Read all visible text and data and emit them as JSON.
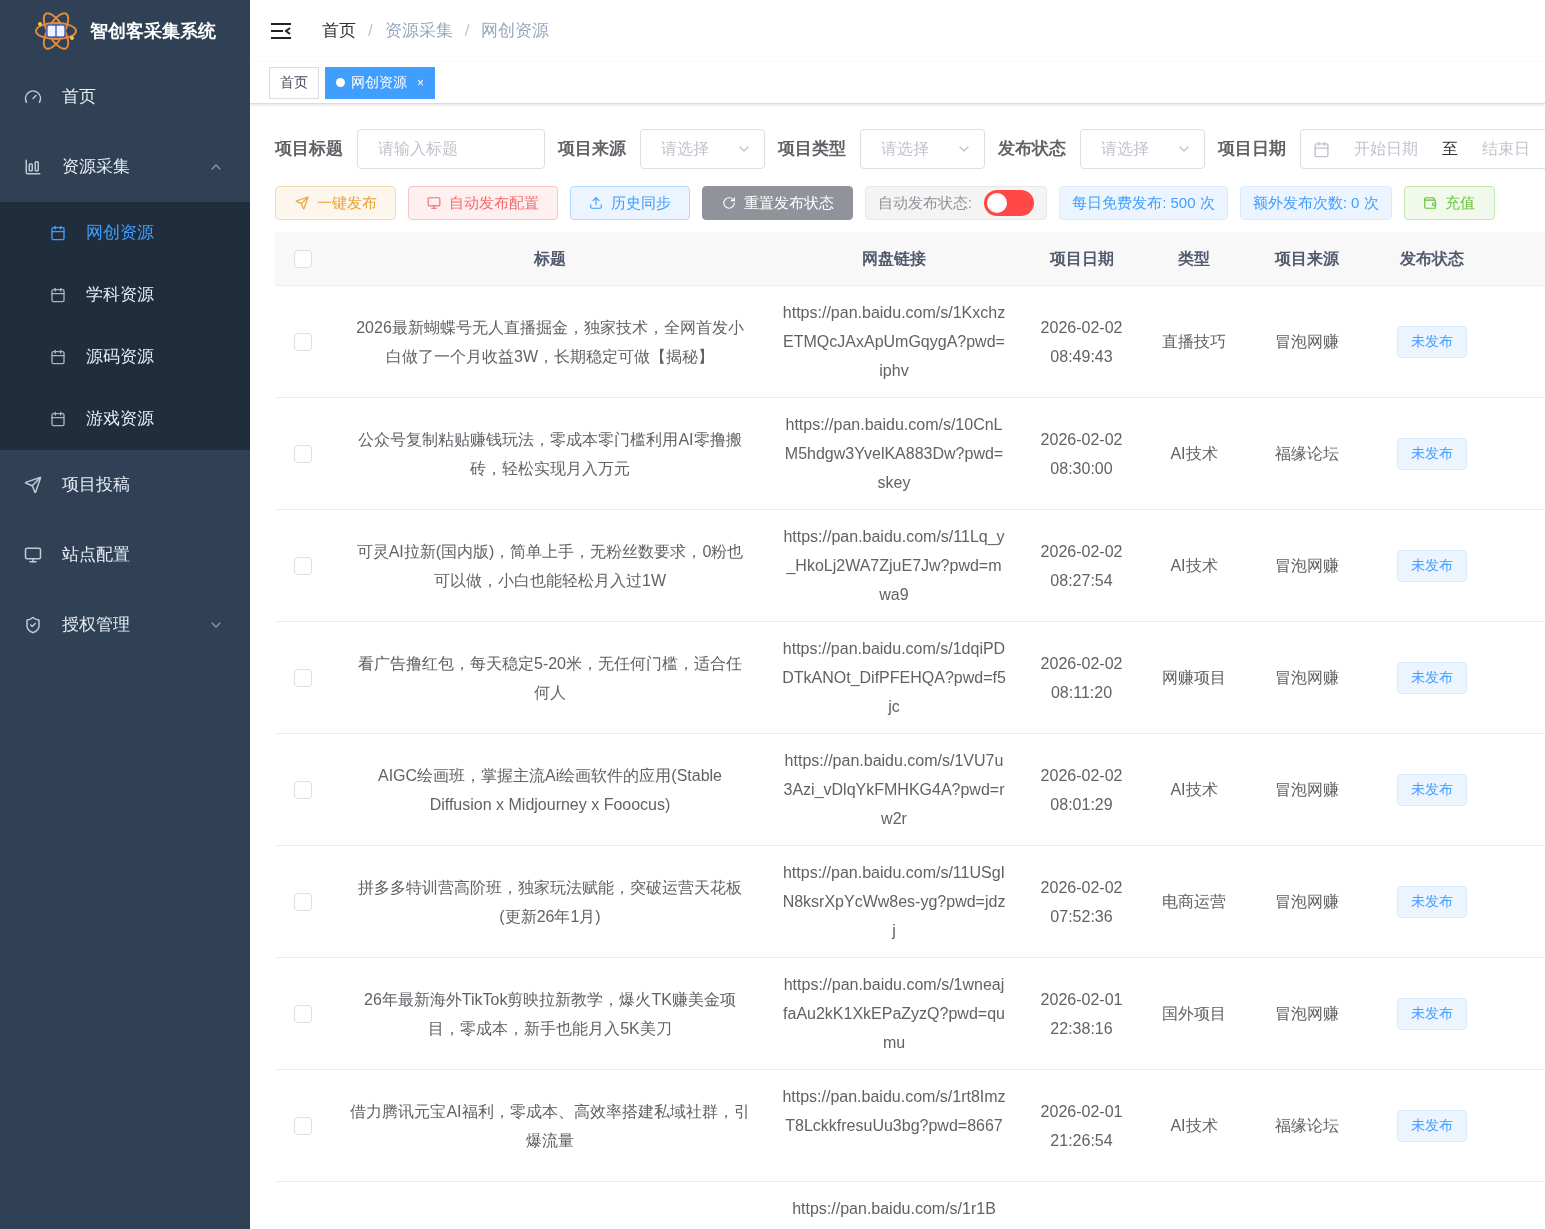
{
  "app": {
    "title": "智创客采集系统"
  },
  "sidebar": {
    "items": [
      {
        "label": "首页",
        "kind": "link",
        "selected": false
      },
      {
        "label": "资源采集",
        "kind": "submenu",
        "selected": false,
        "expanded": true,
        "children": [
          {
            "label": "网创资源",
            "selected": true
          },
          {
            "label": "学科资源",
            "selected": false
          },
          {
            "label": "源码资源",
            "selected": false
          },
          {
            "label": "游戏资源",
            "selected": false
          }
        ]
      },
      {
        "label": "项目投稿",
        "kind": "link",
        "selected": false
      },
      {
        "label": "站点配置",
        "kind": "link",
        "selected": false
      },
      {
        "label": "授权管理",
        "kind": "submenu",
        "selected": false,
        "expanded": false
      }
    ]
  },
  "breadcrumb": {
    "separator": "/",
    "items": [
      "首页",
      "资源采集",
      "网创资源"
    ]
  },
  "tabs": [
    {
      "label": "首页",
      "selected": false
    },
    {
      "label": "网创资源",
      "selected": true,
      "close": "×"
    }
  ],
  "filters": [
    {
      "label": "项目标题",
      "kind": "input",
      "placeholder": "请输入标题"
    },
    {
      "label": "项目来源",
      "kind": "select",
      "placeholder": "请选择"
    },
    {
      "label": "项目类型",
      "kind": "select",
      "placeholder": "请选择"
    },
    {
      "label": "发布状态",
      "kind": "select",
      "placeholder": "请选择"
    },
    {
      "label": "项目日期",
      "kind": "daterange",
      "start_placeholder": "开始日期",
      "separator": "至",
      "end_placeholder": "结束日"
    }
  ],
  "toolbar": [
    {
      "label": "一键发布",
      "kind": "warning"
    },
    {
      "label": "自动发布配置",
      "kind": "danger"
    },
    {
      "label": "历史同步",
      "kind": "primary"
    },
    {
      "label": "重置发布状态",
      "kind": "info"
    },
    {
      "label": "自动发布状态:",
      "kind": "switch",
      "on": false
    },
    {
      "label": "每日免费发布: 500 次",
      "kind": "count"
    },
    {
      "label": "额外发布次数: 0 次",
      "kind": "count"
    },
    {
      "label": "充值",
      "kind": "success"
    }
  ],
  "table": {
    "columns": [
      "标题",
      "网盘链接",
      "项目日期",
      "类型",
      "项目来源",
      "发布状态"
    ],
    "header_checked": false,
    "rows": [
      {
        "checked": false,
        "title": "2026最新蝴蝶号无人直播掘金，独家技术，全网首发小白做了一个月收益3W，长期稳定可做【揭秘】",
        "link": "https://pan.baidu.com/s/1KxchzETMQcJAxApUmGqygA?pwd=iphv",
        "date": "2026-02-02",
        "time": "08:49:43",
        "type": "直播技巧",
        "source": "冒泡网赚",
        "status": "未发布"
      },
      {
        "checked": false,
        "title": "公众号复制粘贴赚钱玩法，零成本零门槛利用AI零撸搬砖，轻松实现月入万元",
        "link": "https://pan.baidu.com/s/10CnLM5hdgw3YvelKA883Dw?pwd=skey",
        "date": "2026-02-02",
        "time": "08:30:00",
        "type": "AI技术",
        "source": "福缘论坛",
        "status": "未发布"
      },
      {
        "checked": false,
        "title": "可灵AI拉新(国内版)，简单上手，无粉丝数要求，0粉也可以做，小白也能轻松月入过1W",
        "link": "https://pan.baidu.com/s/11Lq_y_HkoLj2WA7ZjuE7Jw?pwd=mwa9",
        "date": "2026-02-02",
        "time": "08:27:54",
        "type": "AI技术",
        "source": "冒泡网赚",
        "status": "未发布"
      },
      {
        "checked": false,
        "title": "看广告撸红包，每天稳定5-20米，无任何门槛，适合任何人",
        "link": "https://pan.baidu.com/s/1dqiPDDTkANOt_DifPFEHQA?pwd=f5jc",
        "date": "2026-02-02",
        "time": "08:11:20",
        "type": "网赚项目",
        "source": "冒泡网赚",
        "status": "未发布"
      },
      {
        "checked": false,
        "title": "AIGC绘画班，掌握主流Ai绘画软件的应用(Stable Diffusion x Midjourney x Fooocus)",
        "link": "https://pan.baidu.com/s/1VU7u3Azi_vDlqYkFMHKG4A?pwd=rw2r",
        "date": "2026-02-02",
        "time": "08:01:29",
        "type": "AI技术",
        "source": "冒泡网赚",
        "status": "未发布"
      },
      {
        "checked": false,
        "title": "拼多多特训营高阶班，独家玩法赋能，突破运营天花板(更新26年1月)",
        "link": "https://pan.baidu.com/s/11USgIN8ksrXpYcWw8es-yg?pwd=jdzj",
        "date": "2026-02-02",
        "time": "07:52:36",
        "type": "电商运营",
        "source": "冒泡网赚",
        "status": "未发布"
      },
      {
        "checked": false,
        "title": "26年最新海外TikTok剪映拉新教学，爆火TK赚美金项目，零成本，新手也能月入5K美刀",
        "link": "https://pan.baidu.com/s/1wneajfaAu2kK1XkEPaZyzQ?pwd=qumu",
        "date": "2026-02-01",
        "time": "22:38:16",
        "type": "国外项目",
        "source": "冒泡网赚",
        "status": "未发布"
      },
      {
        "checked": false,
        "title": "借力腾讯元宝AI福利，零成本、高效率搭建私域社群，引爆流量",
        "link": "https://pan.baidu.com/s/1rt8ImzT8LckkfresuUu3bg?pwd=8667",
        "date": "2026-02-01",
        "time": "21:26:54",
        "type": "AI技术",
        "source": "福缘论坛",
        "status": "未发布"
      },
      {
        "link": "https://pan.baidu.com/s/1r1B"
      }
    ]
  }
}
